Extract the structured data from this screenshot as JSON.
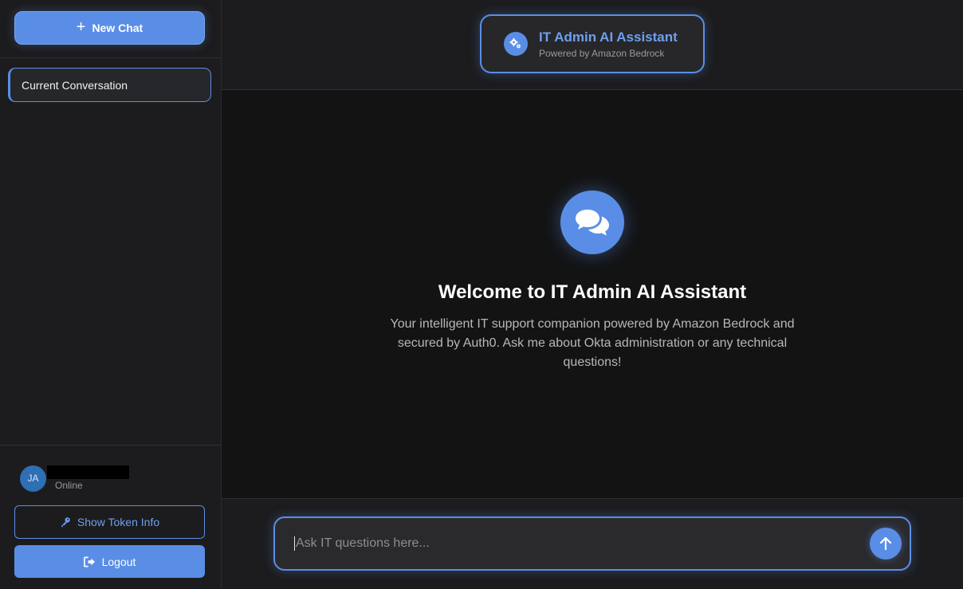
{
  "sidebar": {
    "new_chat_label": "New Chat",
    "conversations": [
      {
        "label": "Current Conversation",
        "active": true
      }
    ],
    "user": {
      "initials": "JA",
      "status": "Online"
    },
    "token_button_label": "Show Token Info",
    "logout_label": "Logout"
  },
  "header": {
    "title": "IT Admin AI Assistant",
    "subtitle": "Powered by Amazon Bedrock"
  },
  "welcome": {
    "title": "Welcome to IT Admin AI Assistant",
    "text": "Your intelligent IT support companion powered by Amazon Bedrock and secured by Auth0. Ask me about Okta administration or any technical questions!"
  },
  "composer": {
    "placeholder": "Ask IT questions here...",
    "value": ""
  },
  "colors": {
    "accent": "#5a8ee6",
    "background": "#131314",
    "panel": "#1c1c1e"
  },
  "icons": {
    "new_chat": "plus-icon",
    "brand": "gears-icon",
    "welcome": "chat-bubbles-icon",
    "token": "key-icon",
    "logout": "sign-out-icon",
    "send": "arrow-up-icon"
  }
}
